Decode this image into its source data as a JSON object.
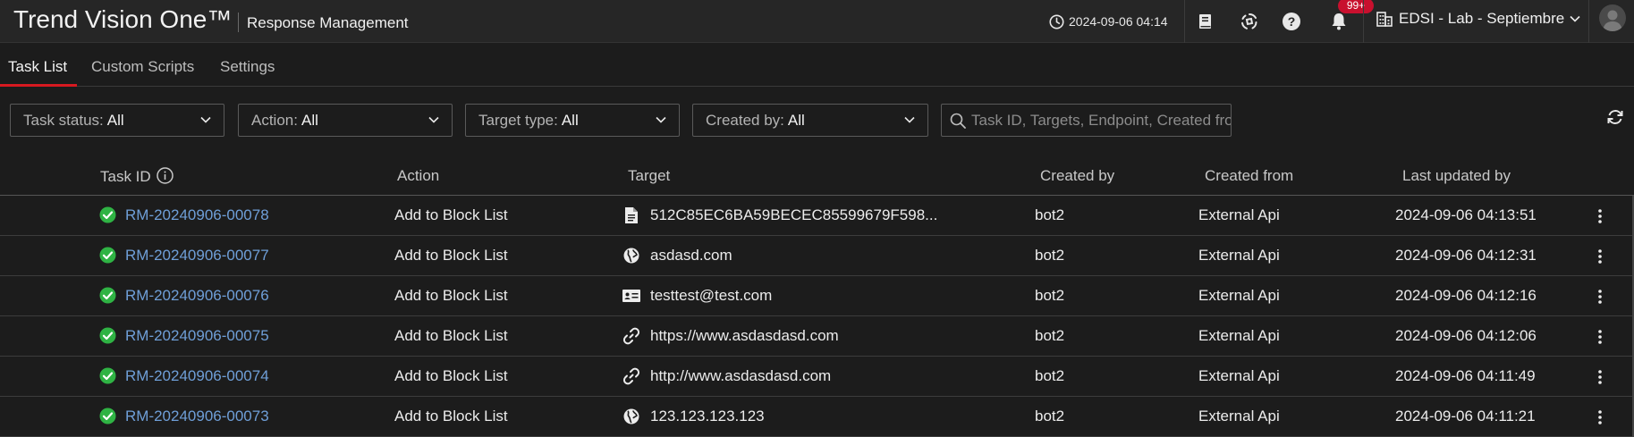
{
  "header": {
    "brand": "Trend Vision One™",
    "app_name": "Response Management",
    "timestamp": "2024-09-06 04:14",
    "notification_count": "99+",
    "tenant": "EDSI - Lab - Septiembre",
    "icons": [
      "clock-icon",
      "docs-icon",
      "ai-assistant-icon",
      "help-icon",
      "bell-icon",
      "building-icon",
      "chevron-down-icon",
      "avatar"
    ]
  },
  "tabs": [
    {
      "label": "Task List",
      "active": true
    },
    {
      "label": "Custom Scripts",
      "active": false
    },
    {
      "label": "Settings",
      "active": false
    }
  ],
  "filters": [
    {
      "label": "Task status:",
      "value": "All"
    },
    {
      "label": "Action:",
      "value": "All"
    },
    {
      "label": "Target type:",
      "value": "All"
    },
    {
      "label": "Created by:",
      "value": "All"
    }
  ],
  "search": {
    "placeholder": "Task ID, Targets, Endpoint, Created from"
  },
  "table": {
    "columns": [
      "Task ID",
      "Action",
      "Target",
      "Created by",
      "Created from",
      "Last updated by"
    ],
    "rows": [
      {
        "task_id": "RM-20240906-00078",
        "action": "Add to Block List",
        "target_icon": "file-icon",
        "target": "512C85EC6BA59BECEC85599679F598...",
        "created_by": "bot2",
        "created_from": "External Api",
        "last_updated": "2024-09-06 04:13:51"
      },
      {
        "task_id": "RM-20240906-00077",
        "action": "Add to Block List",
        "target_icon": "globe-icon",
        "target": "asdasd.com",
        "created_by": "bot2",
        "created_from": "External Api",
        "last_updated": "2024-09-06 04:12:31"
      },
      {
        "task_id": "RM-20240906-00076",
        "action": "Add to Block List",
        "target_icon": "email-icon",
        "target": "testtest@test.com",
        "created_by": "bot2",
        "created_from": "External Api",
        "last_updated": "2024-09-06 04:12:16"
      },
      {
        "task_id": "RM-20240906-00075",
        "action": "Add to Block List",
        "target_icon": "link-icon",
        "target": "https://www.asdasdasd.com",
        "created_by": "bot2",
        "created_from": "External Api",
        "last_updated": "2024-09-06 04:12:06"
      },
      {
        "task_id": "RM-20240906-00074",
        "action": "Add to Block List",
        "target_icon": "link-icon",
        "target": "http://www.asdasdasd.com",
        "created_by": "bot2",
        "created_from": "External Api",
        "last_updated": "2024-09-06 04:11:49"
      },
      {
        "task_id": "RM-20240906-00073",
        "action": "Add to Block List",
        "target_icon": "globe-icon",
        "target": "123.123.123.123",
        "created_by": "bot2",
        "created_from": "External Api",
        "last_updated": "2024-09-06 04:11:21"
      }
    ]
  },
  "colors": {
    "accent": "#d71920",
    "link": "#6f9fd8",
    "success": "#2fb344",
    "background": "#1c1c1c",
    "topbar": "#262626"
  }
}
